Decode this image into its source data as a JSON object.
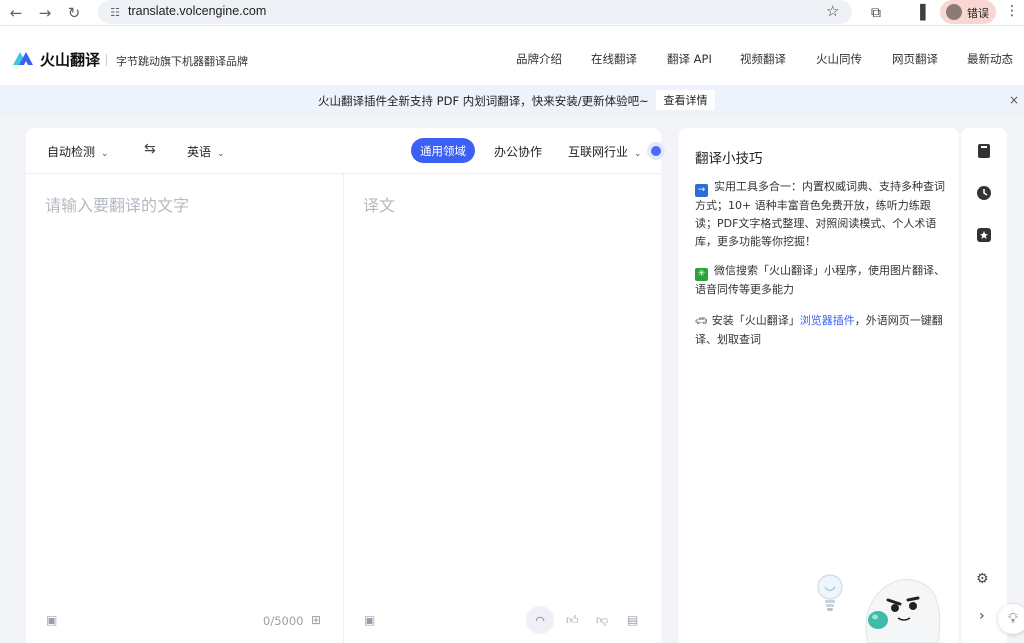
{
  "browser": {
    "url": "translate.volcengine.com",
    "profile_label": "错误"
  },
  "header": {
    "logo_text": "火山翻译",
    "logo_sub": "字节跳动旗下机器翻译品牌",
    "nav": [
      "品牌介绍",
      "在线翻译",
      "翻译 API",
      "视频翻译",
      "火山同传",
      "网页翻译",
      "最新动态"
    ]
  },
  "banner": {
    "text": "火山翻译插件全新支持 PDF 内划词翻译，快来安装/更新体验吧~",
    "button": "查看详情",
    "close": "×"
  },
  "translator": {
    "source_lang": "自动检测",
    "target_lang": "英语",
    "domains": [
      "通用领域",
      "办公协作",
      "互联网行业"
    ],
    "active_domain_index": 0,
    "source_placeholder": "请输入要翻译的文字",
    "target_placeholder": "译文",
    "char_count": "0/5000"
  },
  "tips": {
    "title": "翻译小技巧",
    "items": [
      {
        "text": "实用工具多合一：内置权威词典、支持多种查词方式；10+ 语种丰富音色免费开放，练听力练跟读；PDF文字格式整理、对照阅读模式、个人术语库，更多功能等你挖掘！",
        "icon": "tool-icon",
        "color": "#2a6fd6"
      },
      {
        "text": "微信搜索「火山翻译」小程序，使用图片翻译、语音同传等更多能力",
        "icon": "wechat-icon",
        "color": "#2aa33a"
      },
      {
        "prefix": "安装「火山翻译」",
        "link": "浏览器插件",
        "suffix": "，外语网页一键翻译、划取查词",
        "icon": "car-icon"
      }
    ]
  },
  "colors": {
    "accent": "#3c60f4",
    "page_bg": "#f2f4f8",
    "banner_bg": "#eef2fb"
  }
}
